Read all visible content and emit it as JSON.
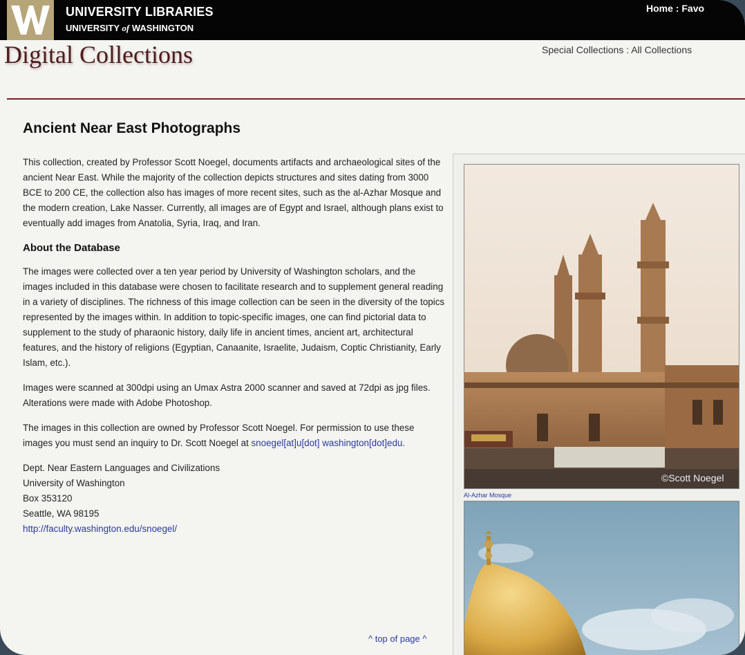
{
  "header": {
    "library_title": "UNIVERSITY LIBRARIES",
    "library_sub_prefix": "UNIVERSITY ",
    "library_sub_of": "of",
    "library_sub_suffix": " WASHINGTON",
    "top_nav": [
      "Home",
      "Favo"
    ],
    "top_nav_sep": " : ",
    "site_title": "Digital Collections",
    "section_nav": [
      "Special Collections",
      "All Collections"
    ],
    "section_nav_sep": " : "
  },
  "main": {
    "title": "Ancient Near East Photographs",
    "intro": "This collection, created by Professor Scott Noegel, documents artifacts and archaeological sites of the ancient Near East. While the majority of the collection depicts structures and sites dating from 3000 BCE to 200 CE, the collection also has images of more recent sites, such as the al-Azhar Mosque and the modern creation, Lake Nasser. Currently, all images are of Egypt and Israel, although plans exist to eventually add images from Anatolia, Syria, Iraq, and Iran.",
    "about_heading": "About the Database",
    "about_p1": "The images were collected over a ten year period by University of Washington scholars, and the images included in this database were chosen to facilitate research and to supplement general reading in a variety of disciplines. The richness of this image collection can be seen in the diversity of the topics represented by the images within. In addition to topic-specific images, one can find pictorial data to supplement to the study of pharaonic history, daily life in ancient times, ancient art, architectural features, and the history of religions (Egyptian, Canaanite, Israelite, Judaism, Coptic Christianity, Early Islam, etc.).",
    "about_p2": "Images were scanned at 300dpi using an Umax Astra 2000 scanner and saved at 72dpi as jpg files. Alterations were made with Adobe Photoshop.",
    "permission_text": "The images in this collection are owned by Professor Scott Noegel. For permission to use these images you must send an inquiry to Dr. Scott Noegel at ",
    "email_link": "snoegel[at]u[dot] washington[dot]edu.",
    "address": [
      "Dept. Near Eastern Languages and Civilizations",
      "University of Washington",
      "Box 353120",
      "Seattle, WA 98195"
    ],
    "faculty_link": "http://faculty.washington.edu/snoegel/",
    "top_of_page": "^ top of page ^"
  },
  "sidebar": {
    "photo1_caption": "Al-Azhar Mosque",
    "photo1_watermark": "©Scott Noegel"
  },
  "colors": {
    "header_bg": "#050505",
    "logo_gold": "#b7a57a",
    "title_maroon": "#4b1c1c",
    "link_blue": "#2a3a9e",
    "rule": "#6b2222"
  }
}
